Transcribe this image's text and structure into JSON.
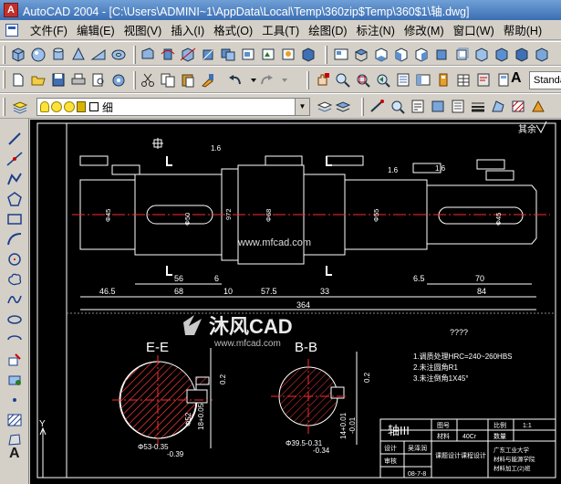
{
  "window": {
    "title": "AutoCAD 2004 - [C:\\Users\\ADMINI~1\\AppData\\Local\\Temp\\360zip$Temp\\360$1\\轴.dwg]",
    "app_icon_letter": "A"
  },
  "menu": [
    "文件(F)",
    "编辑(E)",
    "视图(V)",
    "插入(I)",
    "格式(O)",
    "工具(T)",
    "绘图(D)",
    "标注(N)",
    "修改(M)",
    "窗口(W)",
    "帮助(H)"
  ],
  "toolbar": {
    "text_style_value": "Standa",
    "text_button": "A"
  },
  "layer_toolbar": {
    "current_layer": "细"
  },
  "draw_toolbar": {
    "text_tool": "A"
  },
  "drawing": {
    "corner_note": "其余",
    "watermark_url": "www.mfcad.com",
    "logo_text": "沐风CAD",
    "logo_url": "www.mfcad.com",
    "section_e_label": "E-E",
    "section_b_label": "B-B",
    "question_marks": "????",
    "notes": [
      "1.调质处理HRC=240~260HBS",
      "2.未注圆角R1",
      "3.未注倒角1X45°"
    ],
    "dims_bottom_row1": [
      "56",
      "6",
      "6.5",
      "70"
    ],
    "dims_bottom_row2": [
      "46.5",
      "68",
      "10",
      "57.5",
      "33",
      "84"
    ],
    "dim_overall": "364",
    "dims_dia": [
      "Φ45",
      "Φ50",
      "972",
      "Φ68",
      "Φ55",
      "Φ45"
    ],
    "dim_roughness": [
      "1.6",
      "1.6",
      "1.6"
    ],
    "section_e_dims": [
      "Φ53-0.35",
      "-0.39",
      "18+0.05",
      "Φ52",
      "0.2"
    ],
    "section_b_dims": [
      "Φ39.5-0.31",
      "-0.34",
      "14+0.01",
      "-0.01",
      "0.2"
    ],
    "title_block": {
      "part_name": "轴III",
      "material": "40Cr",
      "scale": "1:1",
      "labels": [
        "图号",
        "比例",
        "材料",
        "数量",
        "设计",
        "审核"
      ],
      "project": "课题设计课程设计",
      "school": "广东工业大学",
      "dept": "材料与能源学院",
      "class": "材料加工(2)班",
      "date": "08-7-8",
      "designer": "吴泽润"
    },
    "colors": {
      "background": "#000000",
      "lines": "#ffffff",
      "centerline": "#ff2a2a",
      "hatch": "#ff3a3a"
    }
  }
}
